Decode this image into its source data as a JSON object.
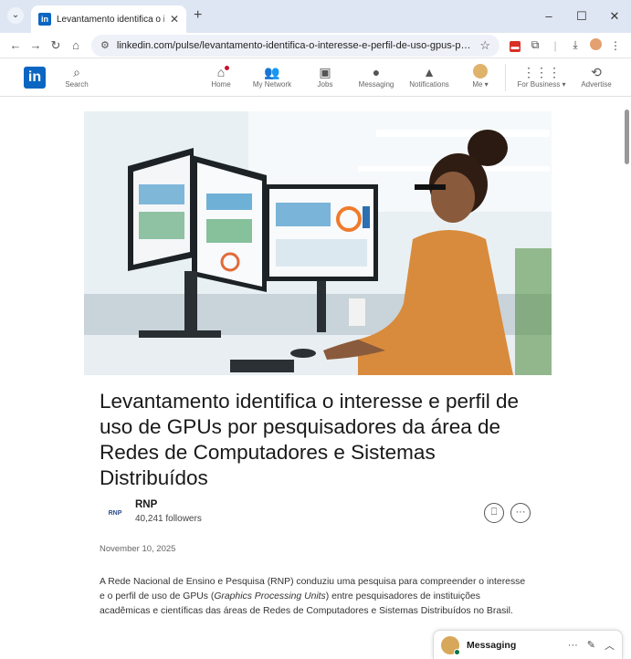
{
  "browser": {
    "tab_title": "Levantamento identifica o intere",
    "tab_favicon": "in",
    "url": "linkedin.com/pulse/levantamento-identifica-o-interesse-e-perfil-de-uso-gpus-por..."
  },
  "nav": {
    "logo": "in",
    "search_label": "Search",
    "items": [
      {
        "label": "Home",
        "icon": "home-icon"
      },
      {
        "label": "My Network",
        "icon": "network-icon"
      },
      {
        "label": "Jobs",
        "icon": "briefcase-icon"
      },
      {
        "label": "Messaging",
        "icon": "chat-icon"
      },
      {
        "label": "Notifications",
        "icon": "bell-icon"
      },
      {
        "label": "Me ▾",
        "icon": "avatar"
      }
    ],
    "business_label": "For Business ▾",
    "advertise_label": "Advertise"
  },
  "article": {
    "title": "Levantamento identifica o interesse e perfil de uso de GPUs por pesquisadores da área de Redes de Computadores e Sistemas Distribuídos",
    "author_name": "RNP",
    "author_logo": "RNP",
    "followers": "40,241 followers",
    "date": "November 10, 2025",
    "body_1": "A Rede Nacional de Ensino e Pesquisa (RNP) conduziu uma pesquisa para compreender o interesse e o perfil de uso de GPUs (",
    "body_em": "Graphics Processing Units",
    "body_2": ") entre pesquisadores de instituições acadêmicas e científicas das áreas de Redes de Computadores e Sistemas Distribuídos no Brasil."
  },
  "messaging": {
    "label": "Messaging",
    "more": "···"
  },
  "colors": {
    "brand": "#0a66c2",
    "notification_badge": "#cb112d",
    "online": "#057642"
  }
}
